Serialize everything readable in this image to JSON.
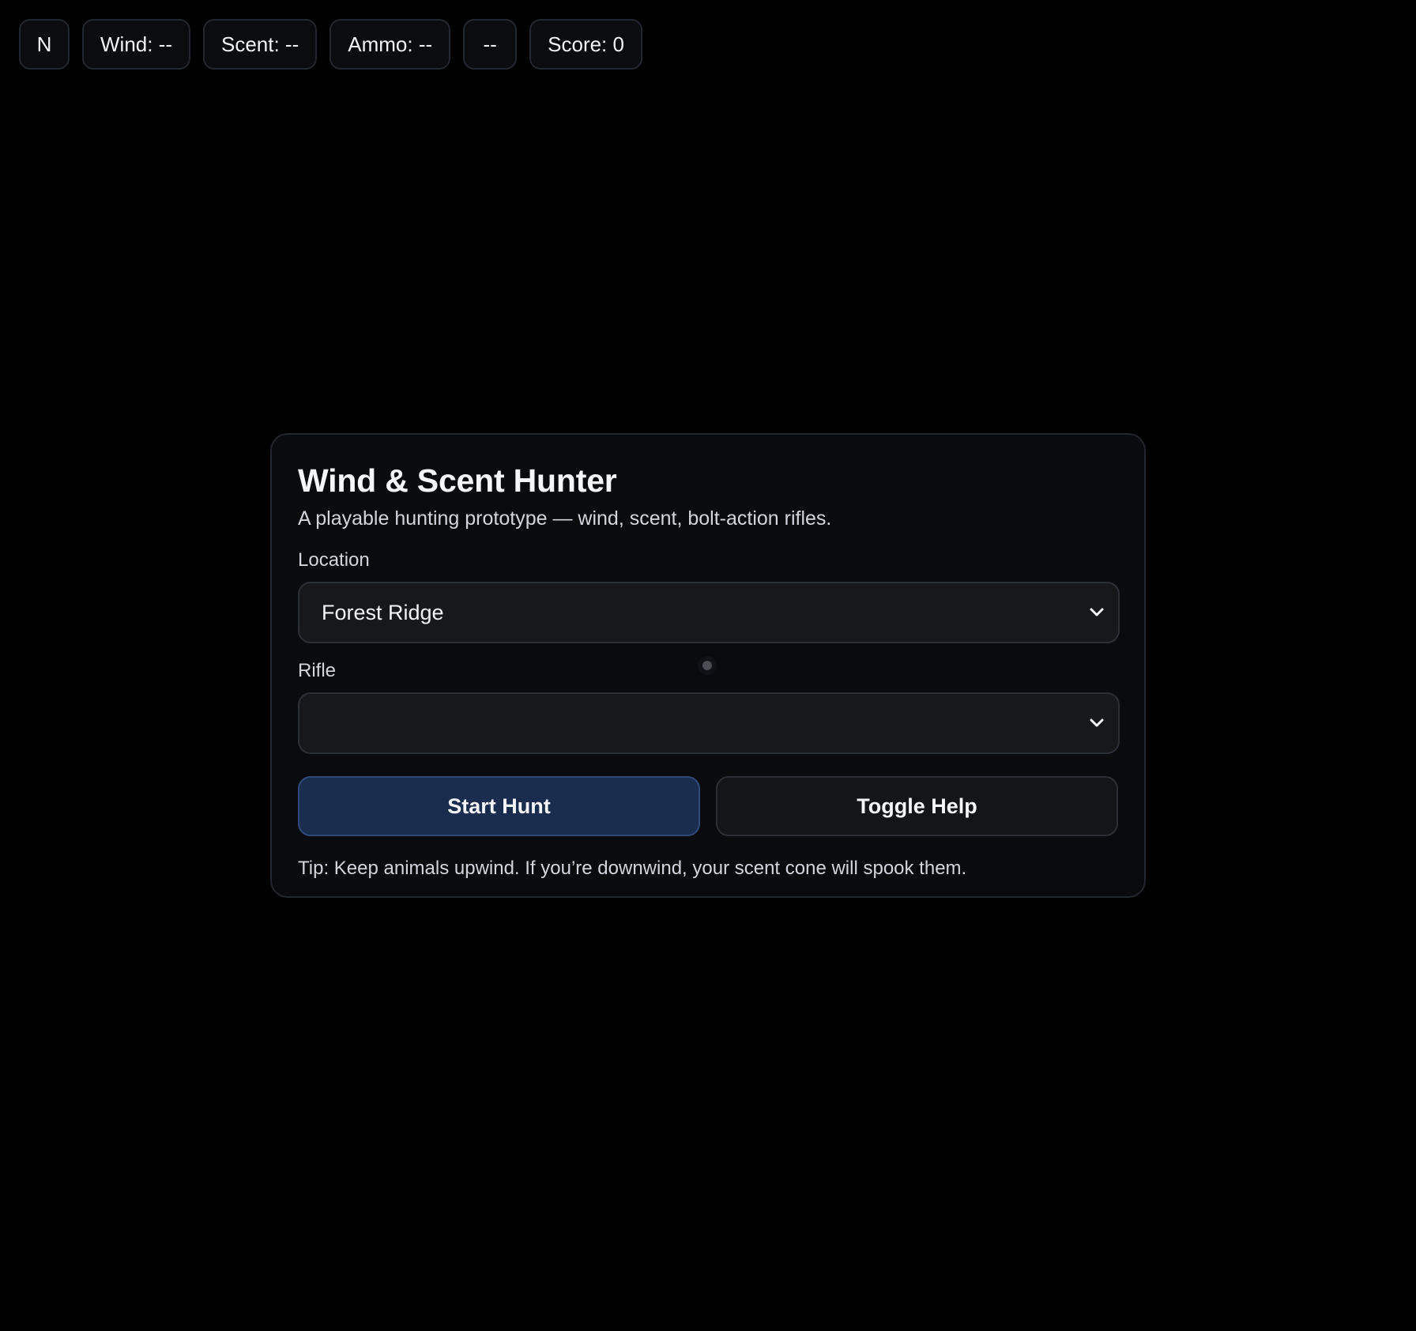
{
  "hud": {
    "compass": "N",
    "wind": "Wind: --",
    "scent": "Scent: --",
    "ammo": "Ammo: --",
    "status": "--",
    "score": "Score: 0"
  },
  "menu": {
    "title": "Wind & Scent Hunter",
    "subtitle": "A playable hunting prototype — wind, scent, bolt-action rifles.",
    "location_label": "Location",
    "location_value": "Forest Ridge",
    "rifle_label": "Rifle",
    "rifle_value": "",
    "start_button": "Start Hunt",
    "help_button": "Toggle Help",
    "tip": "Tip: Keep animals upwind. If you’re downwind, your scent cone will spook them."
  },
  "colors": {
    "background": "#000000",
    "card": "#090b0f",
    "primary_button": "#1b2d4f",
    "secondary_button": "#141518"
  },
  "icons": {
    "select_arrow": "chevron-down-icon"
  }
}
